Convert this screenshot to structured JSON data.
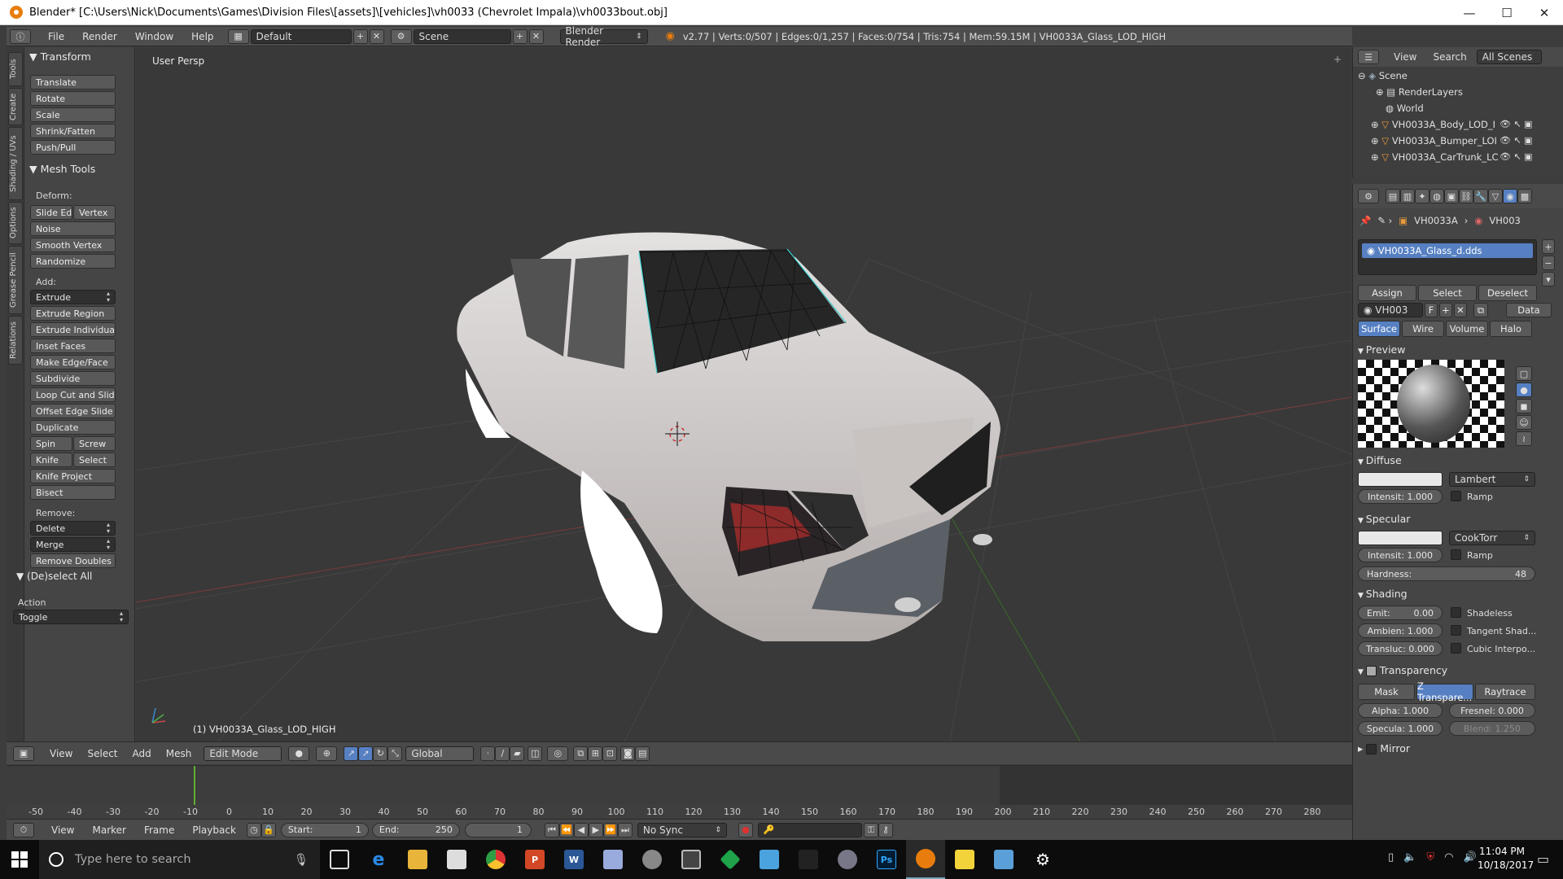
{
  "window": {
    "title": "Blender* [C:\\Users\\Nick\\Documents\\Games\\Division Files\\[assets]\\[vehicles]\\vh0033  (Chevrolet Impala)\\vh0033bout.obj]",
    "minimize": "—",
    "maximize": "☐",
    "close": "✕"
  },
  "header": {
    "menus": [
      "File",
      "Render",
      "Window",
      "Help"
    ],
    "layout": "Default",
    "scene": "Scene",
    "engine": "Blender Render",
    "stats": "v2.77 | Verts:0/507 | Edges:0/1,257 | Faces:0/754 | Tris:754 | Mem:59.15M | VH0033A_Glass_LOD_HIGH"
  },
  "left_tabs": [
    "Tools",
    "Create",
    "Shading / UVs",
    "Options",
    "Grease Pencil",
    "Relations"
  ],
  "tools": {
    "transform_title": "Transform",
    "transform": [
      "Translate",
      "Rotate",
      "Scale",
      "Shrink/Fatten",
      "Push/Pull"
    ],
    "mesh_title": "Mesh Tools",
    "deform_label": "Deform:",
    "slide_edge": "Slide Ed",
    "vertex": "Vertex",
    "deform": [
      "Noise",
      "Smooth Vertex",
      "Randomize"
    ],
    "add_label": "Add:",
    "extrude": "Extrude",
    "add": [
      "Extrude Region",
      "Extrude Individual",
      "Inset Faces",
      "Make Edge/Face",
      "Subdivide",
      "Loop Cut and Slide",
      "Offset Edge Slide",
      "Duplicate"
    ],
    "spin": "Spin",
    "screw": "Screw",
    "knife": "Knife",
    "select": "Select",
    "knife_project": "Knife Project",
    "bisect": "Bisect",
    "remove_label": "Remove:",
    "delete": "Delete",
    "merge": "Merge",
    "remove_doubles": "Remove Doubles",
    "deselect_title": "(De)select All",
    "action_label": "Action",
    "action_value": "Toggle"
  },
  "viewport": {
    "label": "User Persp",
    "object_label": "(1) VH0033A_Glass_LOD_HIGH"
  },
  "view3d_header": {
    "menus": [
      "View",
      "Select",
      "Add",
      "Mesh"
    ],
    "mode": "Edit Mode",
    "orientation": "Global"
  },
  "timeline": {
    "ticks": [
      "-50",
      "-40",
      "-30",
      "-20",
      "-10",
      "0",
      "10",
      "20",
      "30",
      "40",
      "50",
      "60",
      "70",
      "80",
      "90",
      "100",
      "110",
      "120",
      "130",
      "140",
      "150",
      "160",
      "170",
      "180",
      "190",
      "200",
      "210",
      "220",
      "230",
      "240",
      "250",
      "260",
      "270",
      "280"
    ],
    "menus": [
      "View",
      "Marker",
      "Frame",
      "Playback"
    ],
    "start": "Start:",
    "start_value": "1",
    "end": "End:",
    "end_value": "250",
    "current": "1",
    "sync": "No Sync"
  },
  "outliner": {
    "menus": [
      "View",
      "Search"
    ],
    "filter": "All Scenes",
    "items": [
      "Scene",
      "RenderLayers",
      "World",
      "VH0033A_Body_LOD_I",
      "VH0033A_Bumper_LOI",
      "VH0033A_CarTrunk_LC"
    ]
  },
  "properties": {
    "breadcrumb1": "VH0033A",
    "breadcrumb2": "VH003",
    "material_slot": "VH0033A_Glass_d.dds",
    "assign": "Assign",
    "select": "Select",
    "deselect": "Deselect",
    "mat_name": "VH003",
    "fake": "F",
    "data": "Data",
    "tabs": [
      "Surface",
      "Wire",
      "Volume",
      "Halo"
    ],
    "preview": "Preview",
    "diffuse": "Diffuse",
    "diffuse_shader": "Lambert",
    "diffuse_intensity": "Intensit: 1.000",
    "ramp": "Ramp",
    "specular": "Specular",
    "specular_shader": "CookTorr",
    "specular_intensity": "Intensit: 1.000",
    "hardness_label": "Hardness:",
    "hardness": "48",
    "shading": "Shading",
    "emit": "Emit:",
    "emit_value": "0.00",
    "shadeless": "Shadeless",
    "ambient": "Ambien: 1.000",
    "tangent": "Tangent Shad...",
    "translucency": "Transluc: 0.000",
    "cubic": "Cubic Interpo...",
    "transparency": "Transparency",
    "trans_tabs": [
      "Mask",
      "Z Transpare...",
      "Raytrace"
    ],
    "alpha": "Alpha:  1.000",
    "fresnel": "Fresnel: 0.000",
    "specular_alpha": "Specula: 1.000",
    "blend": "Blend:  1.250",
    "mirror": "Mirror"
  },
  "taskbar": {
    "search_placeholder": "Type here to search",
    "time": "11:04 PM",
    "date": "10/18/2017",
    "ps_label": "Ps"
  }
}
